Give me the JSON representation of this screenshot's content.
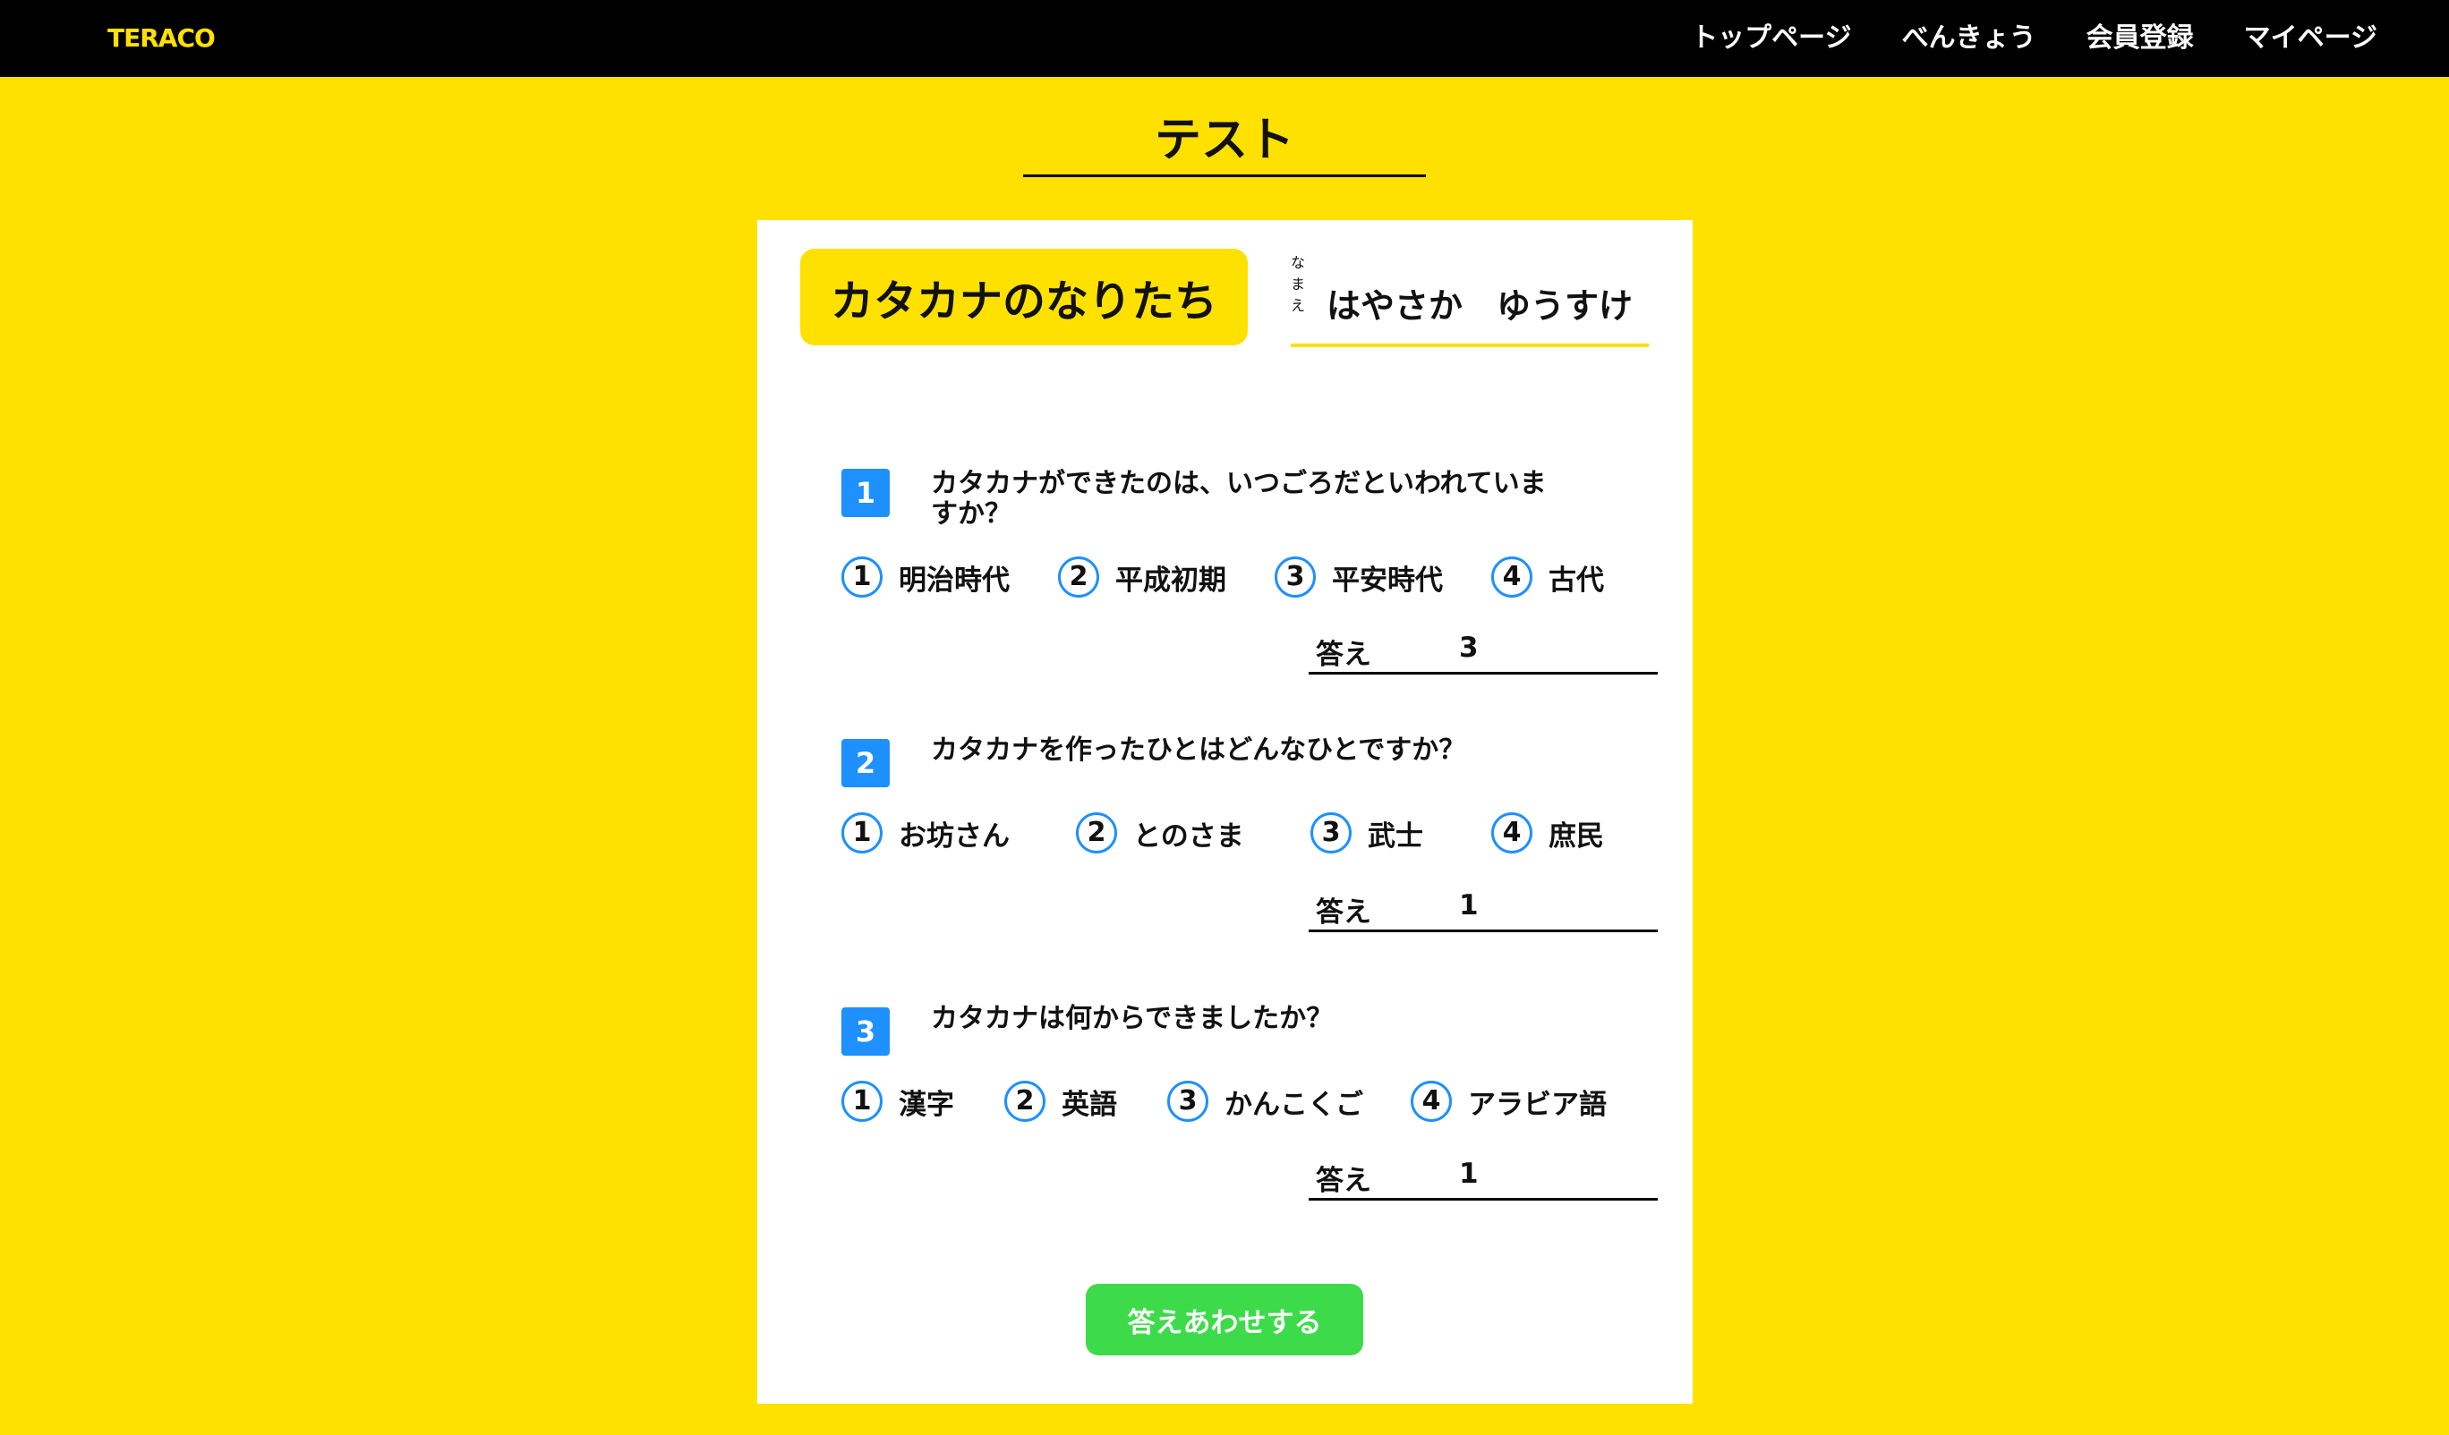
{
  "header": {
    "logo": "TERACO",
    "nav": [
      {
        "label": "トップページ"
      },
      {
        "label": "べんきょう"
      },
      {
        "label": "会員登録"
      },
      {
        "label": "マイページ"
      }
    ]
  },
  "page": {
    "title": "テスト"
  },
  "test": {
    "subject": "カタカナのなりたち",
    "name_ruby": [
      "な",
      "ま",
      "え"
    ],
    "name": "はやさか　ゆうすけ",
    "answer_label": "答え",
    "questions": [
      {
        "number": "1",
        "text": "カタカナができたのは、いつごろだといわれていますか？",
        "options": [
          {
            "num": "1",
            "label": "明治時代"
          },
          {
            "num": "2",
            "label": "平成初期"
          },
          {
            "num": "3",
            "label": "平安時代"
          },
          {
            "num": "4",
            "label": "古代"
          }
        ],
        "answer": "3"
      },
      {
        "number": "2",
        "text": "カタカナを作ったひとはどんなひとですか？",
        "options": [
          {
            "num": "1",
            "label": "お坊さん"
          },
          {
            "num": "2",
            "label": "とのさま"
          },
          {
            "num": "3",
            "label": "武士"
          },
          {
            "num": "4",
            "label": "庶民"
          }
        ],
        "answer": "1"
      },
      {
        "number": "3",
        "text": "カタカナは何からできましたか？",
        "options": [
          {
            "num": "1",
            "label": "漢字"
          },
          {
            "num": "2",
            "label": "英語"
          },
          {
            "num": "3",
            "label": "かんこくご"
          },
          {
            "num": "4",
            "label": "アラビア語"
          }
        ],
        "answer": "1"
      }
    ],
    "submit_label": "答えあわせする"
  },
  "colors": {
    "background": "#FFE100",
    "header": "#000000",
    "accent_blue": "#1E90FF",
    "submit_green": "#3DDB4A"
  }
}
